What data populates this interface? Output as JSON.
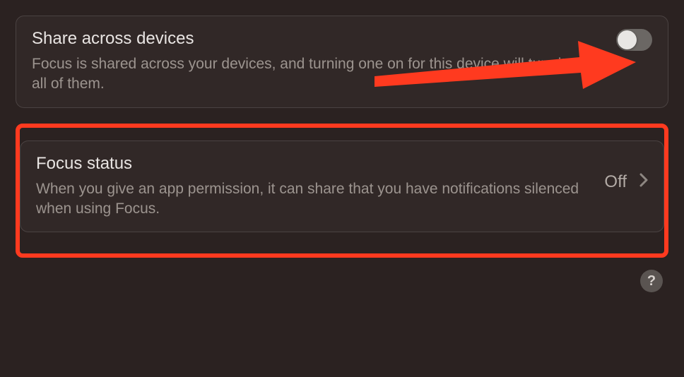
{
  "share": {
    "title": "Share across devices",
    "desc": "Focus is shared across your devices, and turning one on for this device will turn it on for all of them.",
    "toggle_on": false
  },
  "focus_status": {
    "title": "Focus status",
    "desc": "When you give an app permission, it can share that you have notifications silenced when using Focus.",
    "value": "Off"
  },
  "help_label": "?",
  "annotation": {
    "arrow_color": "#ff3a1f",
    "highlight_color": "#ff3a1f"
  }
}
